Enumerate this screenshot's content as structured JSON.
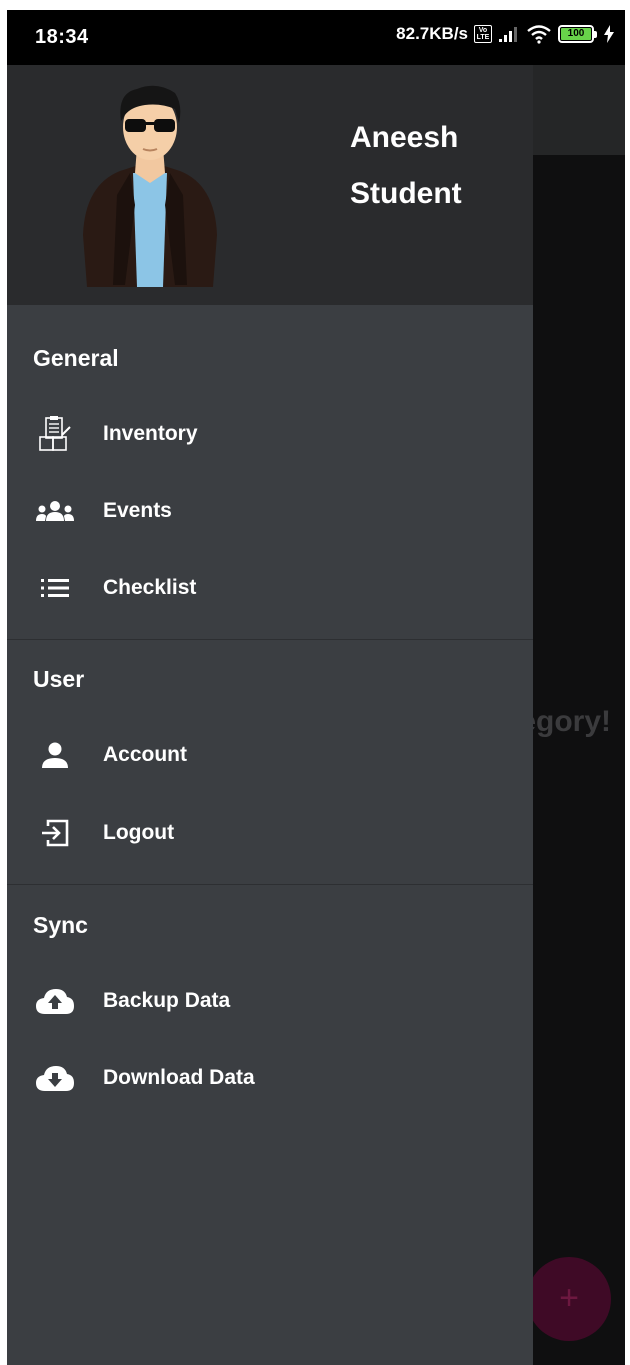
{
  "status_bar": {
    "time": "18:34",
    "network_speed": "82.7KB/s",
    "volte_label": "Vo LTE",
    "battery_level": "100"
  },
  "profile": {
    "name": "Aneesh",
    "role": "Student"
  },
  "sections": [
    {
      "title": "General",
      "items": [
        {
          "label": "Inventory",
          "icon": "inventory-icon"
        },
        {
          "label": "Events",
          "icon": "group-icon"
        },
        {
          "label": "Checklist",
          "icon": "list-icon"
        }
      ]
    },
    {
      "title": "User",
      "items": [
        {
          "label": "Account",
          "icon": "person-icon"
        },
        {
          "label": "Logout",
          "icon": "logout-icon"
        }
      ]
    },
    {
      "title": "Sync",
      "items": [
        {
          "label": "Backup Data",
          "icon": "cloud-upload-icon"
        },
        {
          "label": "Download Data",
          "icon": "cloud-download-icon"
        }
      ]
    }
  ],
  "background": {
    "partial_text": "egory!",
    "fab_label": "+"
  },
  "colors": {
    "drawer": "#3b3e42",
    "header": "#2a2b2d",
    "fab": "#3f0a26"
  }
}
